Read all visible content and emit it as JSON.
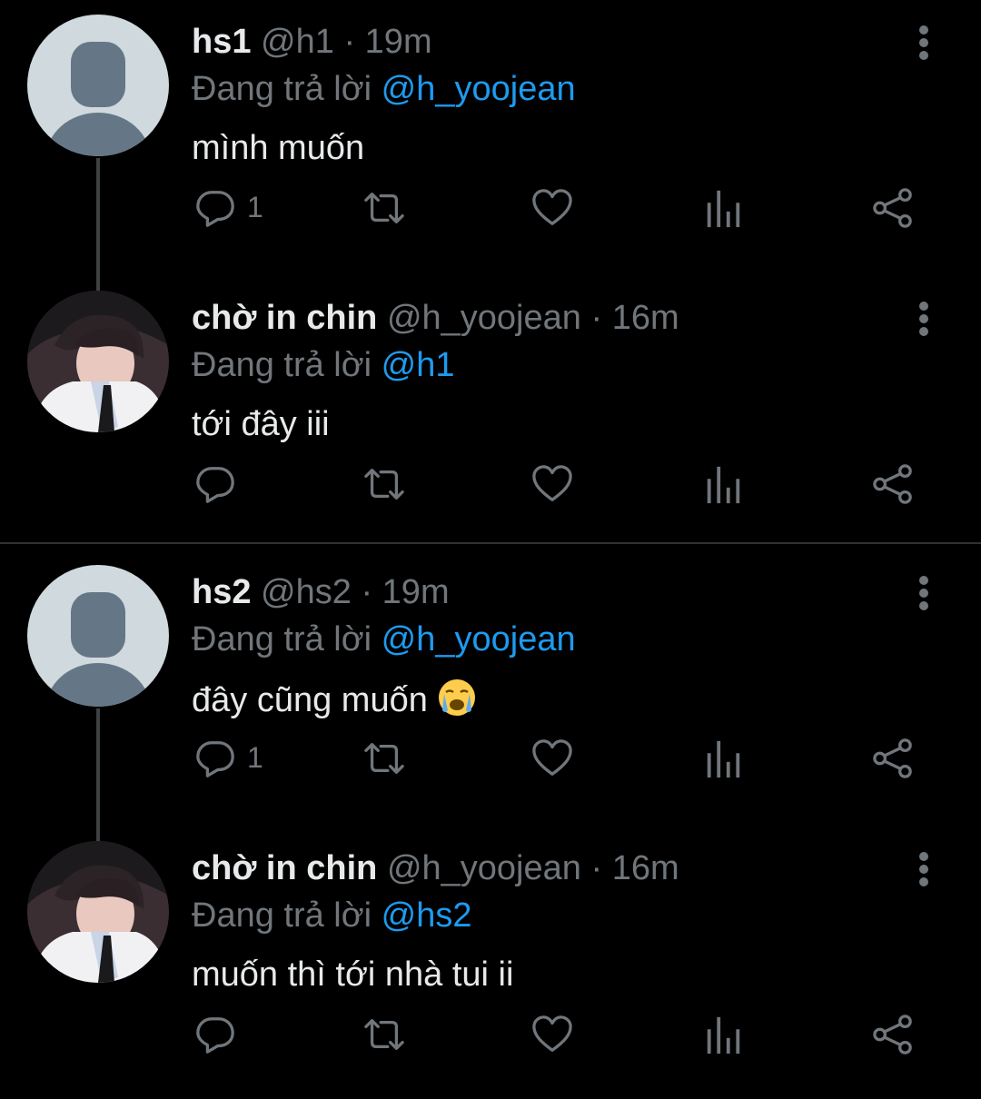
{
  "threads": [
    {
      "tweets": [
        {
          "name": "hs1",
          "handle": "@h1",
          "time": "19m",
          "reply_prefix": "Đang trả lời",
          "reply_to": "@h_yoojean",
          "text": "mình muốn",
          "reply_count": "1",
          "avatar": "default-avatar"
        },
        {
          "name": "chờ in chin",
          "handle": "@h_yoojean",
          "time": "16m",
          "reply_prefix": "Đang trả lời",
          "reply_to": "@h1",
          "text": "tới đây iii",
          "reply_count": "",
          "avatar": "profile-photo"
        }
      ]
    },
    {
      "tweets": [
        {
          "name": "hs2",
          "handle": "@hs2",
          "time": "19m",
          "reply_prefix": "Đang trả lời",
          "reply_to": "@h_yoojean",
          "text": "đây cũng muốn",
          "emoji": "loudly-crying-face",
          "reply_count": "1",
          "avatar": "default-avatar"
        },
        {
          "name": "chờ in chin",
          "handle": "@h_yoojean",
          "time": "16m",
          "reply_prefix": "Đang trả lời",
          "reply_to": "@hs2",
          "text": "muốn thì tới nhà tui ii",
          "reply_count": "",
          "avatar": "profile-photo"
        }
      ]
    }
  ],
  "separator": "·",
  "icons": [
    "reply-icon",
    "retweet-icon",
    "like-icon",
    "analytics-icon",
    "share-icon",
    "more-icon"
  ],
  "colors": {
    "background": "#000000",
    "text": "#e7e9ea",
    "muted": "#71767b",
    "link": "#1d9bf0",
    "default_avatar": "#cfd9de"
  }
}
